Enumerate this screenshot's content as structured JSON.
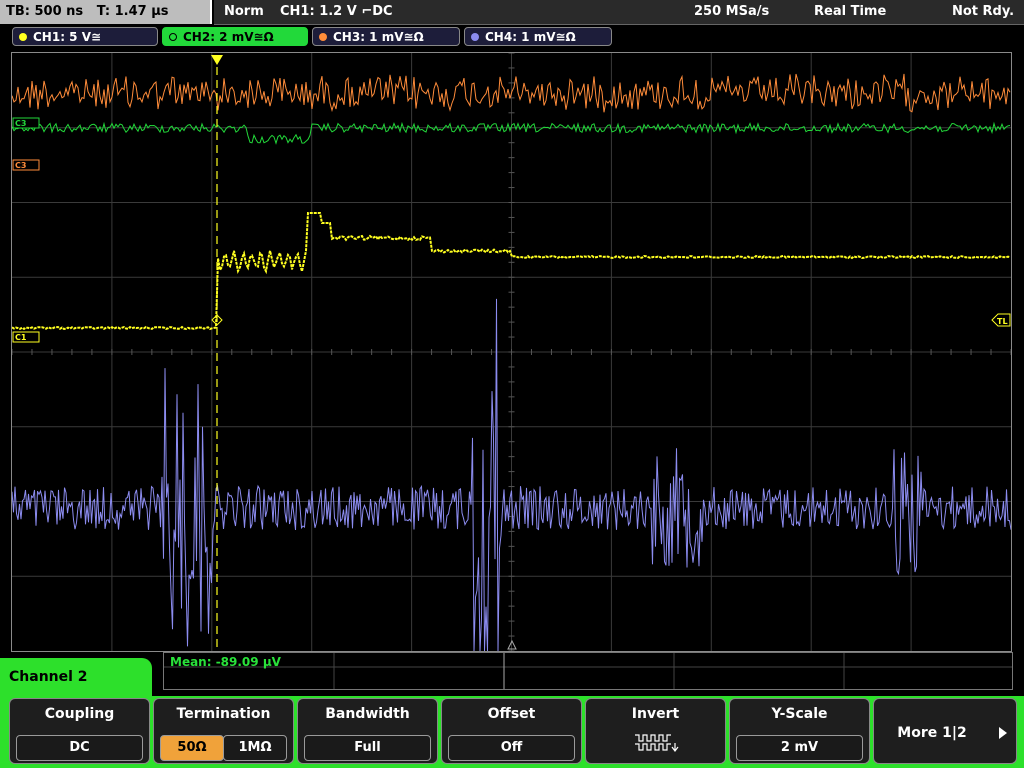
{
  "status": {
    "timebase": "TB: 500 ns",
    "trigger_time": "T: 1.47 µs",
    "mode": "Norm",
    "trigger": "CH1: 1.2 V ⌐DC",
    "sample_rate": "250 MSa/s",
    "acq_mode": "Real Time",
    "state": "Not Rdy."
  },
  "channels": [
    {
      "label": "CH1: 5 V≅",
      "color": "#ffff20"
    },
    {
      "label": "CH2: 2 mV≅Ω",
      "color": "#22d93a"
    },
    {
      "label": "CH3: 1 mV≅Ω",
      "color": "#ff8c3a"
    },
    {
      "label": "CH4: 1 mV≅Ω",
      "color": "#8c8cf0"
    }
  ],
  "markers": {
    "c3_top": "C3",
    "c3": "C3",
    "c1": "C1",
    "tl": "TL"
  },
  "measurement": {
    "label": "Mean: -89.09 µV"
  },
  "menu": {
    "title": "Channel 2",
    "coupling": {
      "title": "Coupling",
      "value": "DC"
    },
    "termination": {
      "title": "Termination",
      "opt1": "50Ω",
      "opt2": "1MΩ"
    },
    "bandwidth": {
      "title": "Bandwidth",
      "value": "Full"
    },
    "offset": {
      "title": "Offset",
      "value": "Off"
    },
    "invert": {
      "title": "Invert"
    },
    "yscale": {
      "title": "Y-Scale",
      "value": "2 mV"
    },
    "more": {
      "title": "More 1|2"
    }
  }
}
